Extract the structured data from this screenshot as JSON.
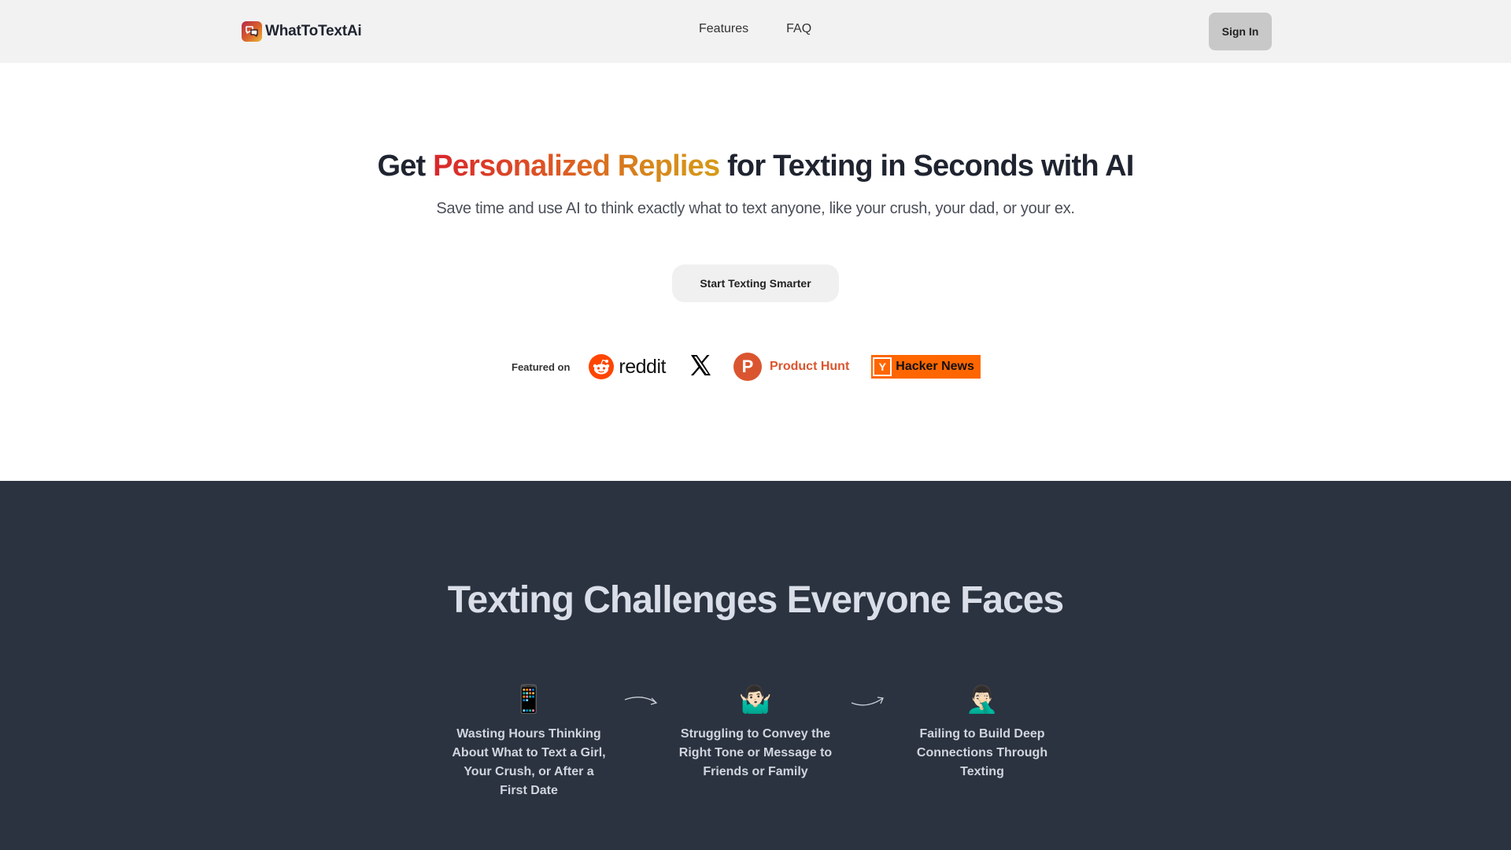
{
  "navbar": {
    "brand_name": "WhatToTextAi",
    "brand_icon": "chat-bubbles-icon",
    "links": [
      {
        "label": "Features"
      },
      {
        "label": "FAQ"
      }
    ],
    "signin_label": "Sign In"
  },
  "hero": {
    "title_prefix": "Get ",
    "title_highlight": "Personalized Replies",
    "title_suffix": " for Texting in Seconds with AI",
    "subtitle": "Save time and use AI to think exactly what to text anyone, like your crush, your dad, or your ex.",
    "cta_label": "Start Texting Smarter",
    "gradient_colors": [
      "#d9262c",
      "#dd5a23",
      "#d6861d",
      "#d69a18"
    ]
  },
  "featured": {
    "label": "Featured on",
    "platforms": [
      {
        "name": "reddit",
        "icon": "reddit-icon",
        "color": "#ff4500"
      },
      {
        "name": "X",
        "icon": "x-icon",
        "color": "#000000"
      },
      {
        "name": "Product Hunt",
        "icon": "product-hunt-icon",
        "letter": "P",
        "color": "#da552f"
      },
      {
        "name": "Hacker News",
        "icon": "hacker-news-icon",
        "letter": "Y",
        "color": "#ff6600"
      }
    ]
  },
  "challenges": {
    "title": "Texting Challenges Everyone Faces",
    "items": [
      {
        "emoji": "📱",
        "icon": "mobile-phone-icon",
        "text": "Wasting Hours Thinking About What to Text a Girl, Your Crush, or After a First Date"
      },
      {
        "emoji": "🤷🏻‍♂️",
        "icon": "shrug-icon",
        "text": "Struggling to Convey the Right Tone or Message to Friends or Family"
      },
      {
        "emoji": "🤦🏻‍♂️",
        "icon": "facepalm-icon",
        "text": "Failing to Build Deep Connections Through Texting"
      }
    ]
  },
  "colors": {
    "navbar_bg": "#f2f2f2",
    "dark_section_bg": "#2b3340",
    "heading_dark": "#1f2430"
  }
}
